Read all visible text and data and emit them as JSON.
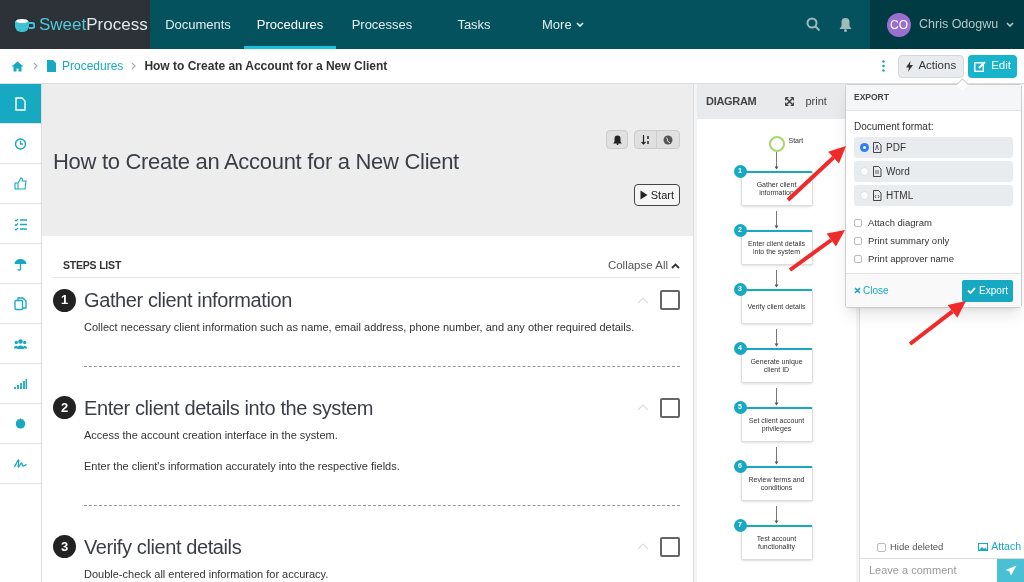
{
  "logo": {
    "light": "Sweet",
    "bold": "Process"
  },
  "nav": [
    {
      "label": "Documents",
      "selected": false
    },
    {
      "label": "Procedures",
      "selected": true
    },
    {
      "label": "Processes",
      "selected": false
    },
    {
      "label": "Tasks",
      "selected": false
    }
  ],
  "more": "More",
  "user": {
    "initials": "CO",
    "name": "Chris Odogwu"
  },
  "breadcrumb": {
    "section": "Procedures",
    "current": "How to Create an Account for a New Client"
  },
  "toolbar": {
    "actions": "Actions",
    "edit": "Edit"
  },
  "sidebar": {
    "items": [
      {
        "kind": "document",
        "selected": true
      },
      {
        "kind": "clock",
        "selected": false
      },
      {
        "kind": "thumb",
        "selected": false
      },
      {
        "kind": "checklist",
        "selected": false
      },
      {
        "kind": "umbrella",
        "selected": false
      },
      {
        "kind": "copy",
        "selected": false
      },
      {
        "kind": "users",
        "selected": false
      },
      {
        "kind": "bars",
        "selected": false
      },
      {
        "kind": "badge",
        "selected": false
      },
      {
        "kind": "signature",
        "selected": false
      }
    ]
  },
  "procedure": {
    "title": "How to Create an Account for a New Client",
    "start": "Start"
  },
  "steps_list": {
    "heading": "STEPS LIST",
    "collapse": "Collapse All",
    "steps": [
      {
        "number": "1",
        "title": "Gather client information",
        "paragraphs": [
          "Collect necessary client information such as name, email address, phone number, and any other required details."
        ],
        "checked": false
      },
      {
        "number": "2",
        "title": "Enter client details into the system",
        "paragraphs": [
          "Access the account creation interface in the system.",
          "Enter the client's information accurately into the respective fields."
        ],
        "checked": false
      },
      {
        "number": "3",
        "title": "Verify client details",
        "paragraphs": [
          "Double-check all entered information for accuracy."
        ],
        "checked": false
      }
    ]
  },
  "diagram": {
    "title": "DIAGRAM",
    "print": "print",
    "start": "Start",
    "nodes": [
      {
        "number": "1",
        "label": "Gather client information"
      },
      {
        "number": "2",
        "label": "Enter client details into the system"
      },
      {
        "number": "3",
        "label": "Verify client details"
      },
      {
        "number": "4",
        "label": "Generate unique client ID"
      },
      {
        "number": "5",
        "label": "Set client account privileges"
      },
      {
        "number": "6",
        "label": "Review terms and conditions"
      },
      {
        "number": "7",
        "label": "Test account functionality"
      }
    ]
  },
  "export": {
    "title": "EXPORT",
    "format_label": "Document format:",
    "formats": [
      {
        "kind": "pdf",
        "label": "PDF",
        "selected": true
      },
      {
        "kind": "word",
        "label": "Word",
        "selected": false
      },
      {
        "kind": "html",
        "label": "HTML",
        "selected": false
      }
    ],
    "options": [
      {
        "label": "Attach diagram",
        "checked": false
      },
      {
        "label": "Print summary only",
        "checked": false
      },
      {
        "label": "Print approver name",
        "checked": false
      }
    ],
    "close": "Close",
    "export": "Export"
  },
  "comments": {
    "hide_deleted": {
      "label": "Hide deleted",
      "checked": false
    },
    "attach": "Attach",
    "placeholder": "Leave a comment"
  }
}
